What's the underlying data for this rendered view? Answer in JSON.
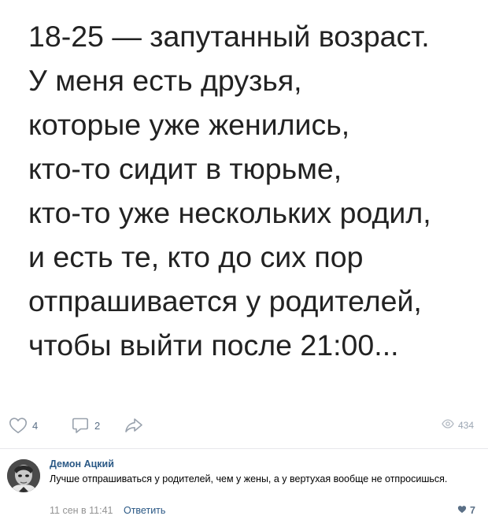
{
  "post": {
    "lines": [
      "18-25 — запутанный возраст.",
      "У меня есть друзья,",
      "которые уже женились,",
      "кто-то сидит в тюрьме,",
      "кто-то уже нескольких родил,",
      "и есть те, кто до сих пор",
      "отпрашивается у родителей,",
      "чтобы выйти после 21:00..."
    ]
  },
  "actions": {
    "likes": "4",
    "comments": "2",
    "views": "434",
    "icons": {
      "like": "heart-icon",
      "comment": "comment-icon",
      "share": "share-icon",
      "views": "eye-icon"
    }
  },
  "comment": {
    "author": "Демон Ацкий",
    "text": "Лучше отпрашиваться у родителей, чем у жены, а у вертухая вообще не отпросишься.",
    "date": "11 сен в 11:41",
    "reply_label": "Ответить",
    "likes": "7",
    "icons": {
      "like": "heart-icon",
      "avatar": "avatar"
    }
  },
  "colors": {
    "text": "#222222",
    "link": "#2a5885",
    "icon": "#99a2ad",
    "meta": "#939393"
  }
}
